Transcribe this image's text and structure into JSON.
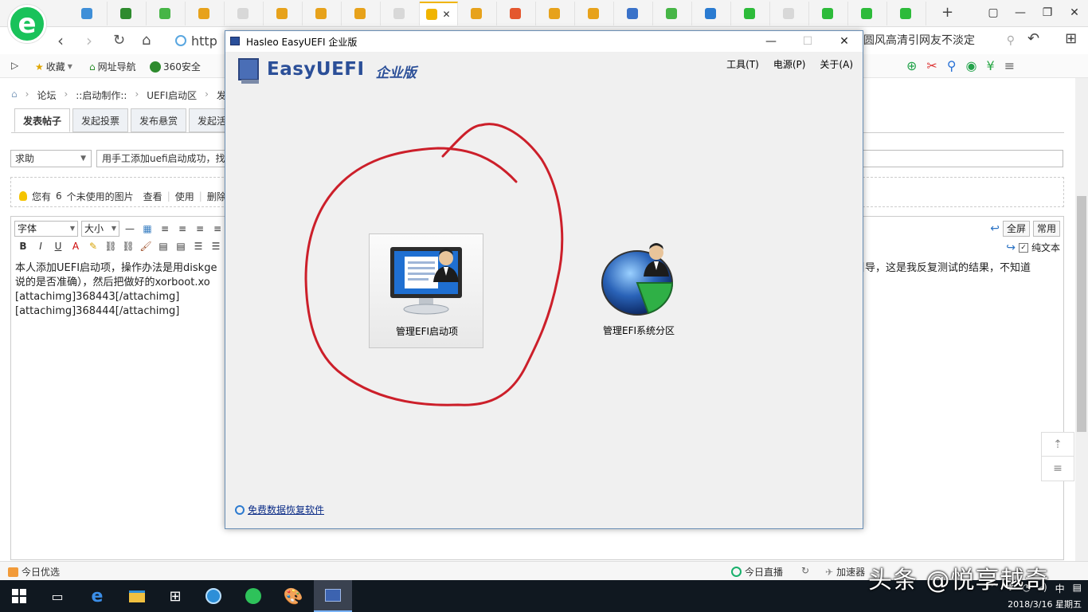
{
  "browser": {
    "address_prefix": "http",
    "search_text": "圆风高清引网友不淡定",
    "tabs": [
      {
        "icon": "gear-icon",
        "label": "",
        "color": "#3f8fd8",
        "active": false
      },
      {
        "icon": "360-icon",
        "label": "",
        "color": "#2e8b2e",
        "active": false
      },
      {
        "icon": "browser-icon",
        "label": "",
        "color": "#46b546",
        "active": false
      },
      {
        "icon": "forum-icon",
        "label": "",
        "color": "#e7a21b",
        "active": false
      },
      {
        "icon": "page-icon",
        "label": "",
        "color": "#d8d8d8",
        "active": false
      },
      {
        "icon": "forum-icon",
        "label": "",
        "color": "#e7a21b",
        "active": false
      },
      {
        "icon": "forum-icon",
        "label": "",
        "color": "#e7a21b",
        "active": false
      },
      {
        "icon": "forum-icon",
        "label": "",
        "color": "#e7a21b",
        "active": false
      },
      {
        "icon": "page-icon",
        "label": "",
        "color": "#d8d8d8",
        "active": false
      },
      {
        "icon": "trophy-icon",
        "label": "",
        "color": "#f0b400",
        "active": true
      },
      {
        "icon": "forum-icon",
        "label": "",
        "color": "#e7a21b",
        "active": false
      },
      {
        "icon": "taobao-icon",
        "label": "",
        "color": "#e4572e",
        "active": false
      },
      {
        "icon": "forum-icon",
        "label": "",
        "color": "#e7a21b",
        "active": false
      },
      {
        "icon": "forum-icon",
        "label": "",
        "color": "#e7a21b",
        "active": false
      },
      {
        "icon": "chrome-icon",
        "label": "",
        "color": "#3a72c9",
        "active": false
      },
      {
        "icon": "browser-icon",
        "label": "",
        "color": "#46b546",
        "active": false
      },
      {
        "icon": "shield-icon",
        "label": "",
        "color": "#2a7bd1",
        "active": false
      },
      {
        "icon": "wechat-icon",
        "label": "",
        "color": "#2dbb3a",
        "active": false
      },
      {
        "icon": "page-icon",
        "label": "",
        "color": "#d8d8d8",
        "active": false
      },
      {
        "icon": "wechat-icon",
        "label": "",
        "color": "#2dbb3a",
        "active": false
      },
      {
        "icon": "wechat-icon",
        "label": "",
        "color": "#2dbb3a",
        "active": false
      },
      {
        "icon": "wechat-icon",
        "label": "",
        "color": "#2dbb3a",
        "active": false
      }
    ],
    "bookmarks": {
      "favorites": "收藏",
      "nav": "网址导航",
      "safety": "360安全"
    }
  },
  "forum": {
    "breadcrumb": [
      "论坛",
      "::启动制作::",
      "UEFI启动区",
      "发表"
    ],
    "post_tabs": [
      "发表帖子",
      "发起投票",
      "发布悬赏",
      "发起活"
    ],
    "type_select": "求助",
    "title_input": "用手工添加uefi启动成功，找",
    "image_notice": {
      "prefix": "您有",
      "count": "6",
      "suffix": "个未使用的图片",
      "view": "查看",
      "use": "使用",
      "delete": "删除"
    },
    "editor": {
      "font_select": "字体",
      "size_select": "大小",
      "fullscreen": "全屏",
      "common": "常用",
      "plain_text": "纯文本",
      "line1_left": "本人添加UEFI启动项，操作办法是用diskge",
      "line1_right": "引导，这是我反复测试的结果，不知道",
      "line2": "说的是否准确），然后把做好的xorboot.xo",
      "line3": "[attachimg]368443[/attachimg]",
      "line4": "[attachimg]368444[/attachimg]"
    }
  },
  "statusbar": {
    "today_pick": "今日优选",
    "today_live": "今日直播",
    "accelerator": "加速器"
  },
  "taskbar": {
    "time": "2018/3/16 星期五",
    "ime": "中"
  },
  "watermark": "头条 @悦享越奇",
  "dialog": {
    "title": "Hasleo EasyUEFI 企业版",
    "brand_name": "EasyUEFI",
    "brand_edition": "企业版",
    "menu": [
      "工具(T)",
      "电源(P)",
      "关于(A)"
    ],
    "cards": [
      {
        "label": "管理EFI启动项",
        "icon": "monitor-user-icon"
      },
      {
        "label": "管理EFI系统分区",
        "icon": "disk-user-icon"
      }
    ],
    "footer_link": "免费数据恢复软件"
  },
  "colors": {
    "accent": "#2b4f98",
    "annotation": "#cc1f2a",
    "taskbar": "#101820"
  }
}
